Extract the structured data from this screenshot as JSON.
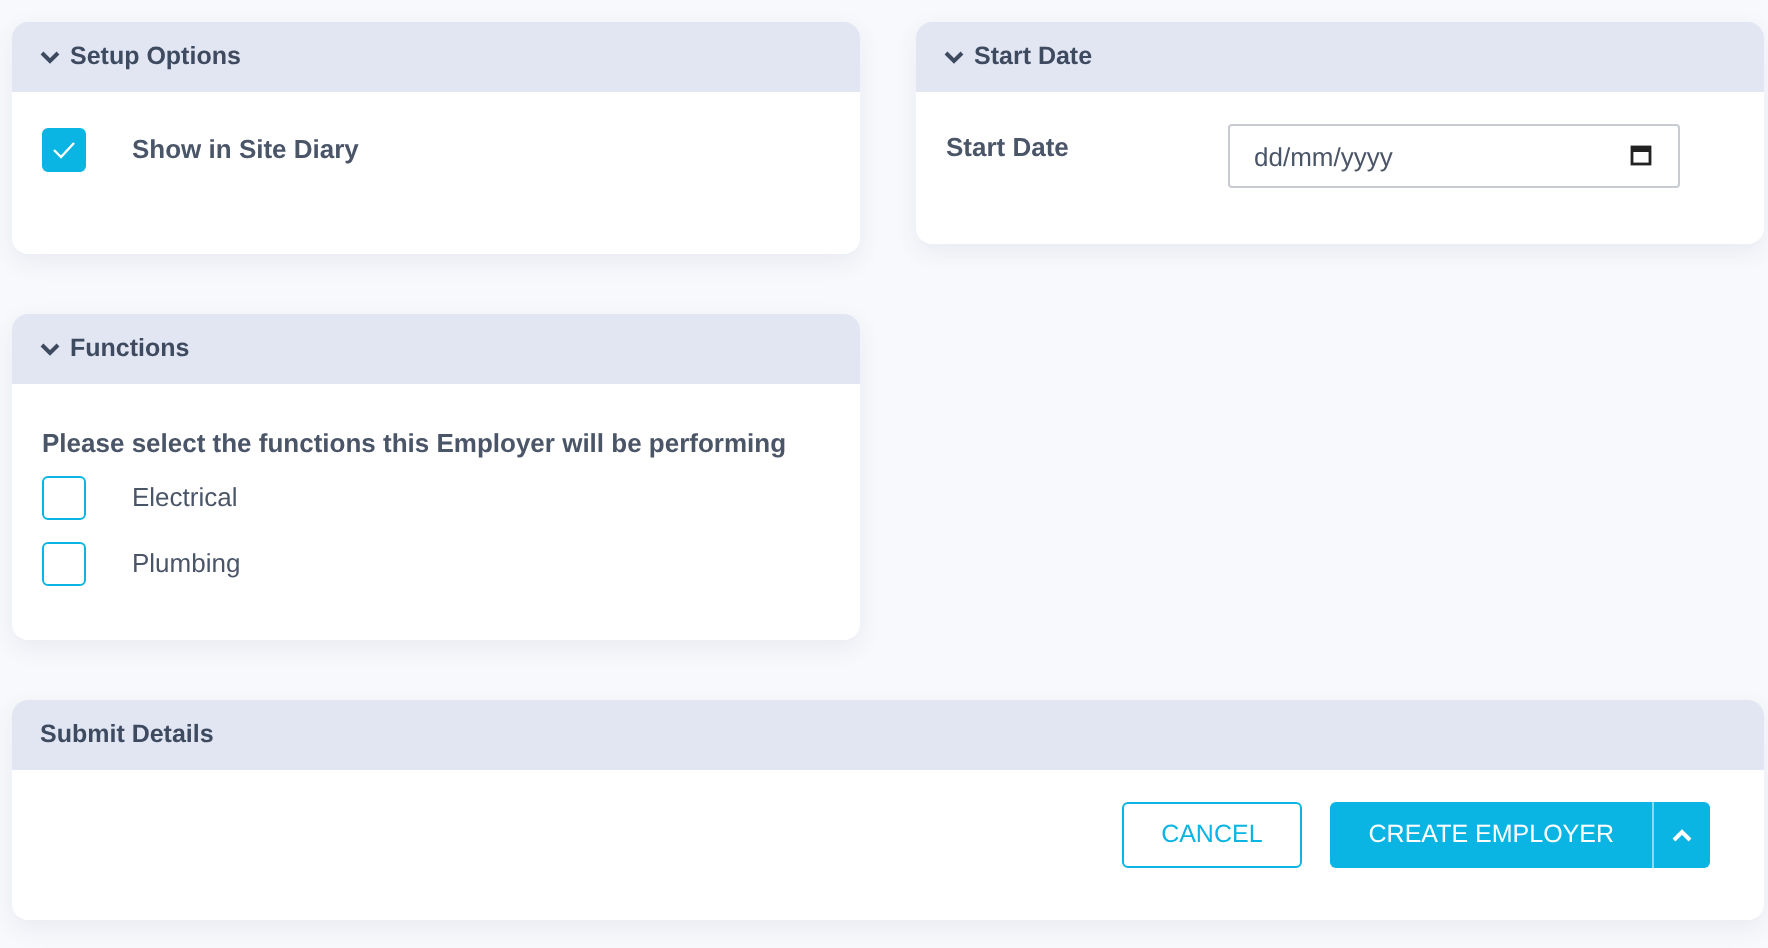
{
  "setup_options": {
    "title": "Setup Options",
    "options": [
      {
        "label": "Show in Site Diary",
        "checked": true
      }
    ]
  },
  "start_date": {
    "title": "Start Date",
    "label": "Start Date",
    "placeholder": "dd/mm/yyyy"
  },
  "functions": {
    "title": "Functions",
    "prompt": "Please select the functions this Employer will be performing",
    "options": [
      {
        "label": "Electrical",
        "checked": false
      },
      {
        "label": "Plumbing",
        "checked": false
      }
    ]
  },
  "submit": {
    "title": "Submit Details",
    "buttons": [
      {
        "kind": "outline",
        "label": "CANCEL"
      },
      {
        "kind": "split",
        "label": "CREATE EMPLOYER"
      }
    ]
  }
}
